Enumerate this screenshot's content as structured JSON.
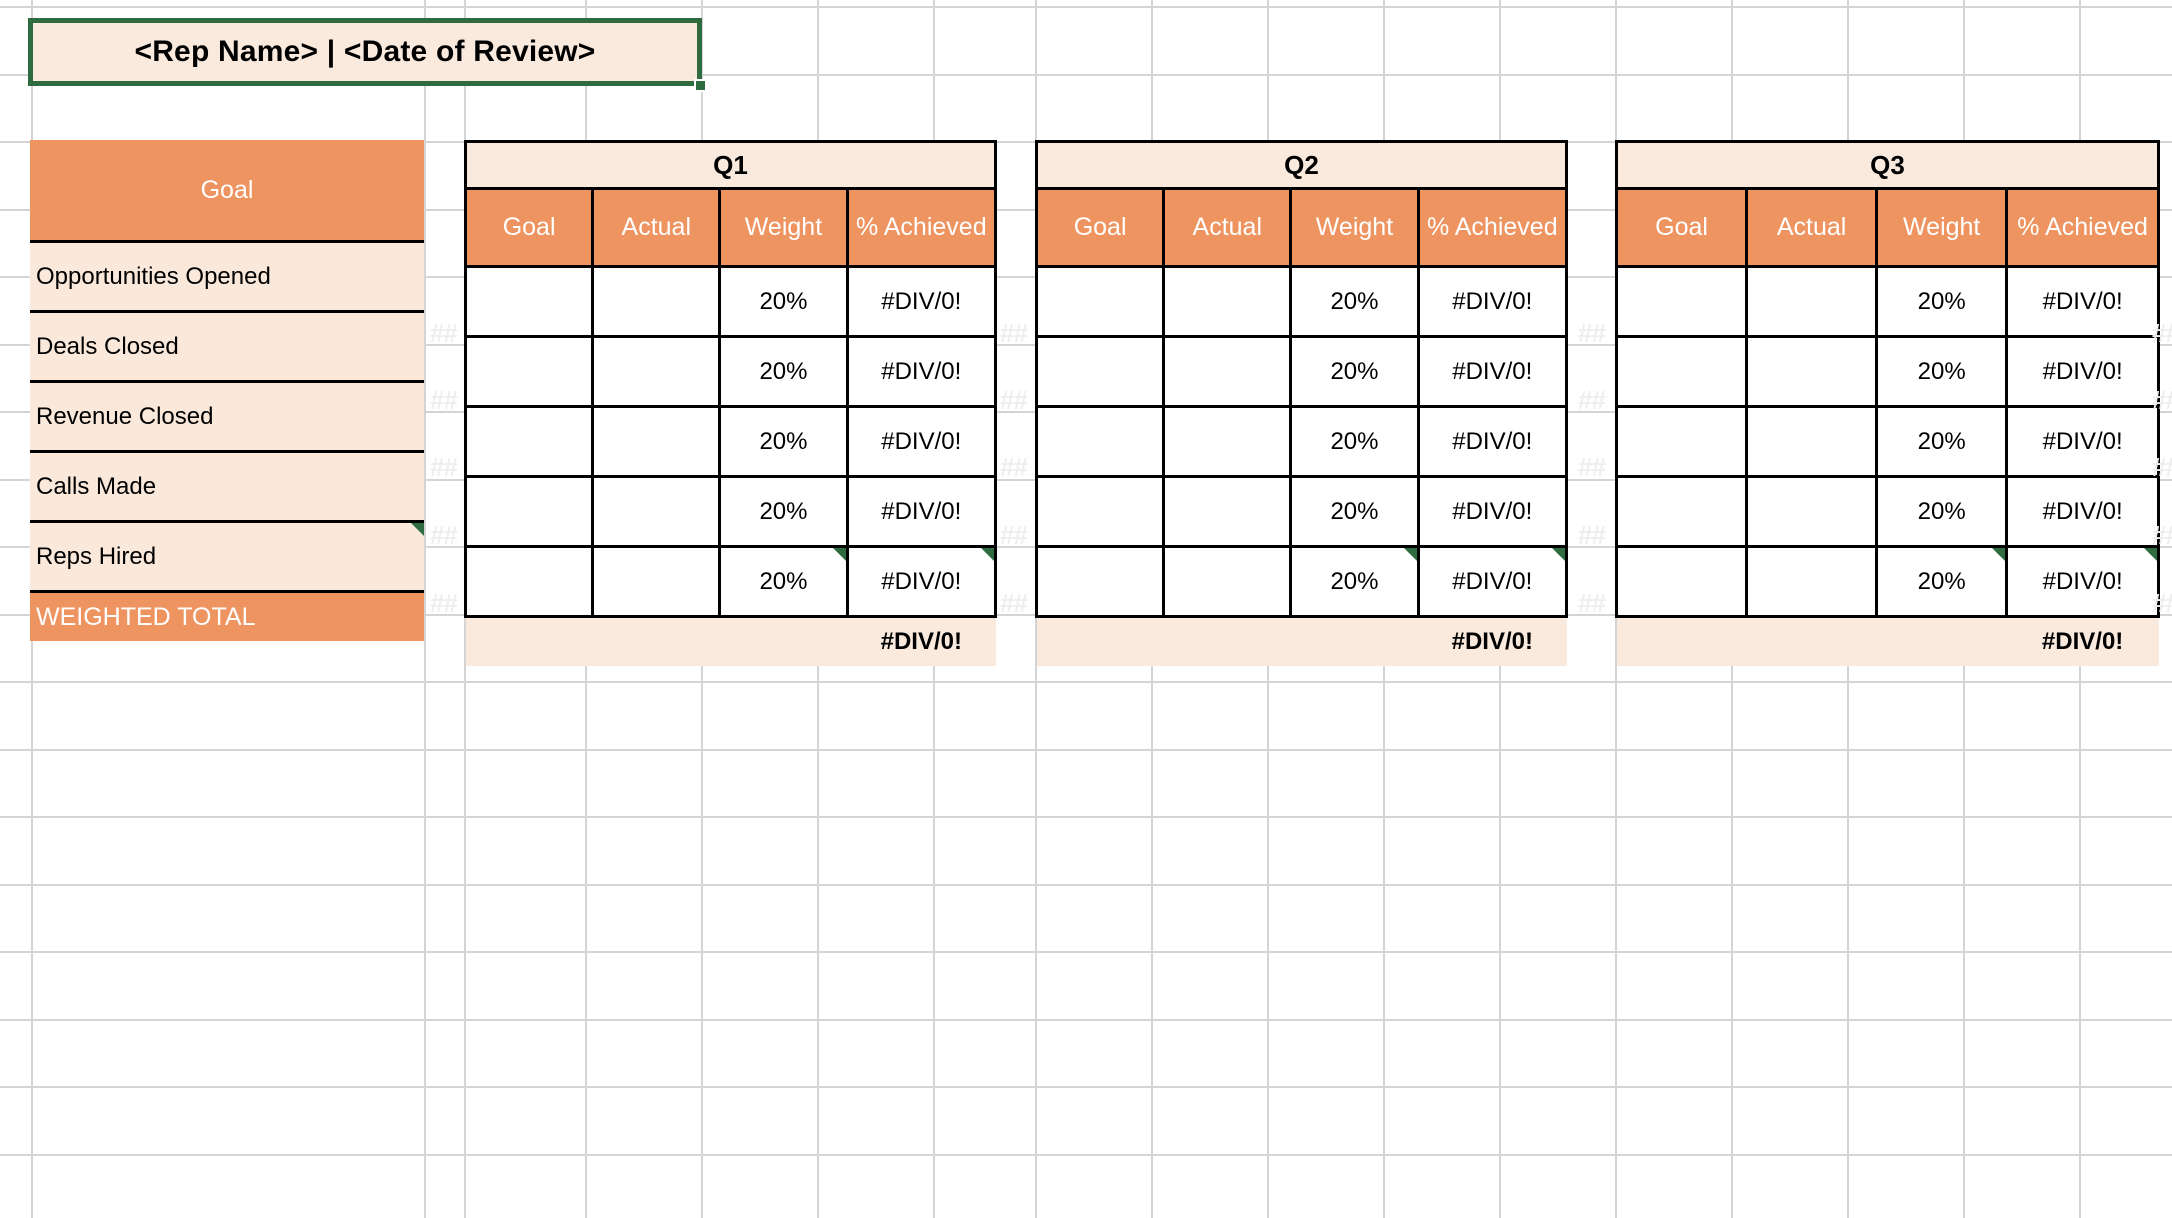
{
  "title": {
    "text": "<Rep Name> | <Date of Review>"
  },
  "goal_table": {
    "header": "Goal",
    "rows": [
      "Opportunities Opened",
      "Deals Closed",
      "Revenue Closed",
      "Calls Made",
      "Reps Hired"
    ],
    "total_label": "WEIGHTED TOTAL"
  },
  "quarters": [
    {
      "label": "Q1",
      "columns": [
        "Goal",
        "Actual",
        "Weight",
        "% Achieved"
      ],
      "rows": [
        {
          "goal": "",
          "actual": "",
          "weight": "20%",
          "achieved": "#DIV/0!"
        },
        {
          "goal": "",
          "actual": "",
          "weight": "20%",
          "achieved": "#DIV/0!"
        },
        {
          "goal": "",
          "actual": "",
          "weight": "20%",
          "achieved": "#DIV/0!"
        },
        {
          "goal": "",
          "actual": "",
          "weight": "20%",
          "achieved": "#DIV/0!"
        },
        {
          "goal": "",
          "actual": "",
          "weight": "20%",
          "achieved": "#DIV/0!"
        }
      ],
      "total": {
        "goal": "",
        "actual": "",
        "weight": "",
        "achieved": "#DIV/0!"
      }
    },
    {
      "label": "Q2",
      "columns": [
        "Goal",
        "Actual",
        "Weight",
        "% Achieved"
      ],
      "rows": [
        {
          "goal": "",
          "actual": "",
          "weight": "20%",
          "achieved": "#DIV/0!"
        },
        {
          "goal": "",
          "actual": "",
          "weight": "20%",
          "achieved": "#DIV/0!"
        },
        {
          "goal": "",
          "actual": "",
          "weight": "20%",
          "achieved": "#DIV/0!"
        },
        {
          "goal": "",
          "actual": "",
          "weight": "20%",
          "achieved": "#DIV/0!"
        },
        {
          "goal": "",
          "actual": "",
          "weight": "20%",
          "achieved": "#DIV/0!"
        }
      ],
      "total": {
        "goal": "",
        "actual": "",
        "weight": "",
        "achieved": "#DIV/0!"
      }
    },
    {
      "label": "Q3",
      "columns": [
        "Goal",
        "Actual",
        "Weight",
        "% Achieved"
      ],
      "rows": [
        {
          "goal": "",
          "actual": "",
          "weight": "20%",
          "achieved": "#DIV/0!"
        },
        {
          "goal": "",
          "actual": "",
          "weight": "20%",
          "achieved": "#DIV/0!"
        },
        {
          "goal": "",
          "actual": "",
          "weight": "20%",
          "achieved": "#DIV/0!"
        },
        {
          "goal": "",
          "actual": "",
          "weight": "20%",
          "achieved": "#DIV/0!"
        },
        {
          "goal": "",
          "actual": "",
          "weight": "20%",
          "achieved": "#DIV/0!"
        }
      ],
      "total": {
        "goal": "",
        "actual": "",
        "weight": "",
        "achieved": "#DIV/0!"
      }
    }
  ],
  "overflow_indicator": "##",
  "colors": {
    "accent_orange": "#ee9460",
    "light_peach": "#fae8db",
    "banner_peach": "#faeade",
    "selection_green": "#2e6b3e",
    "gridline": "#d4d4d4",
    "overflow_gray": "#eeeeee"
  }
}
